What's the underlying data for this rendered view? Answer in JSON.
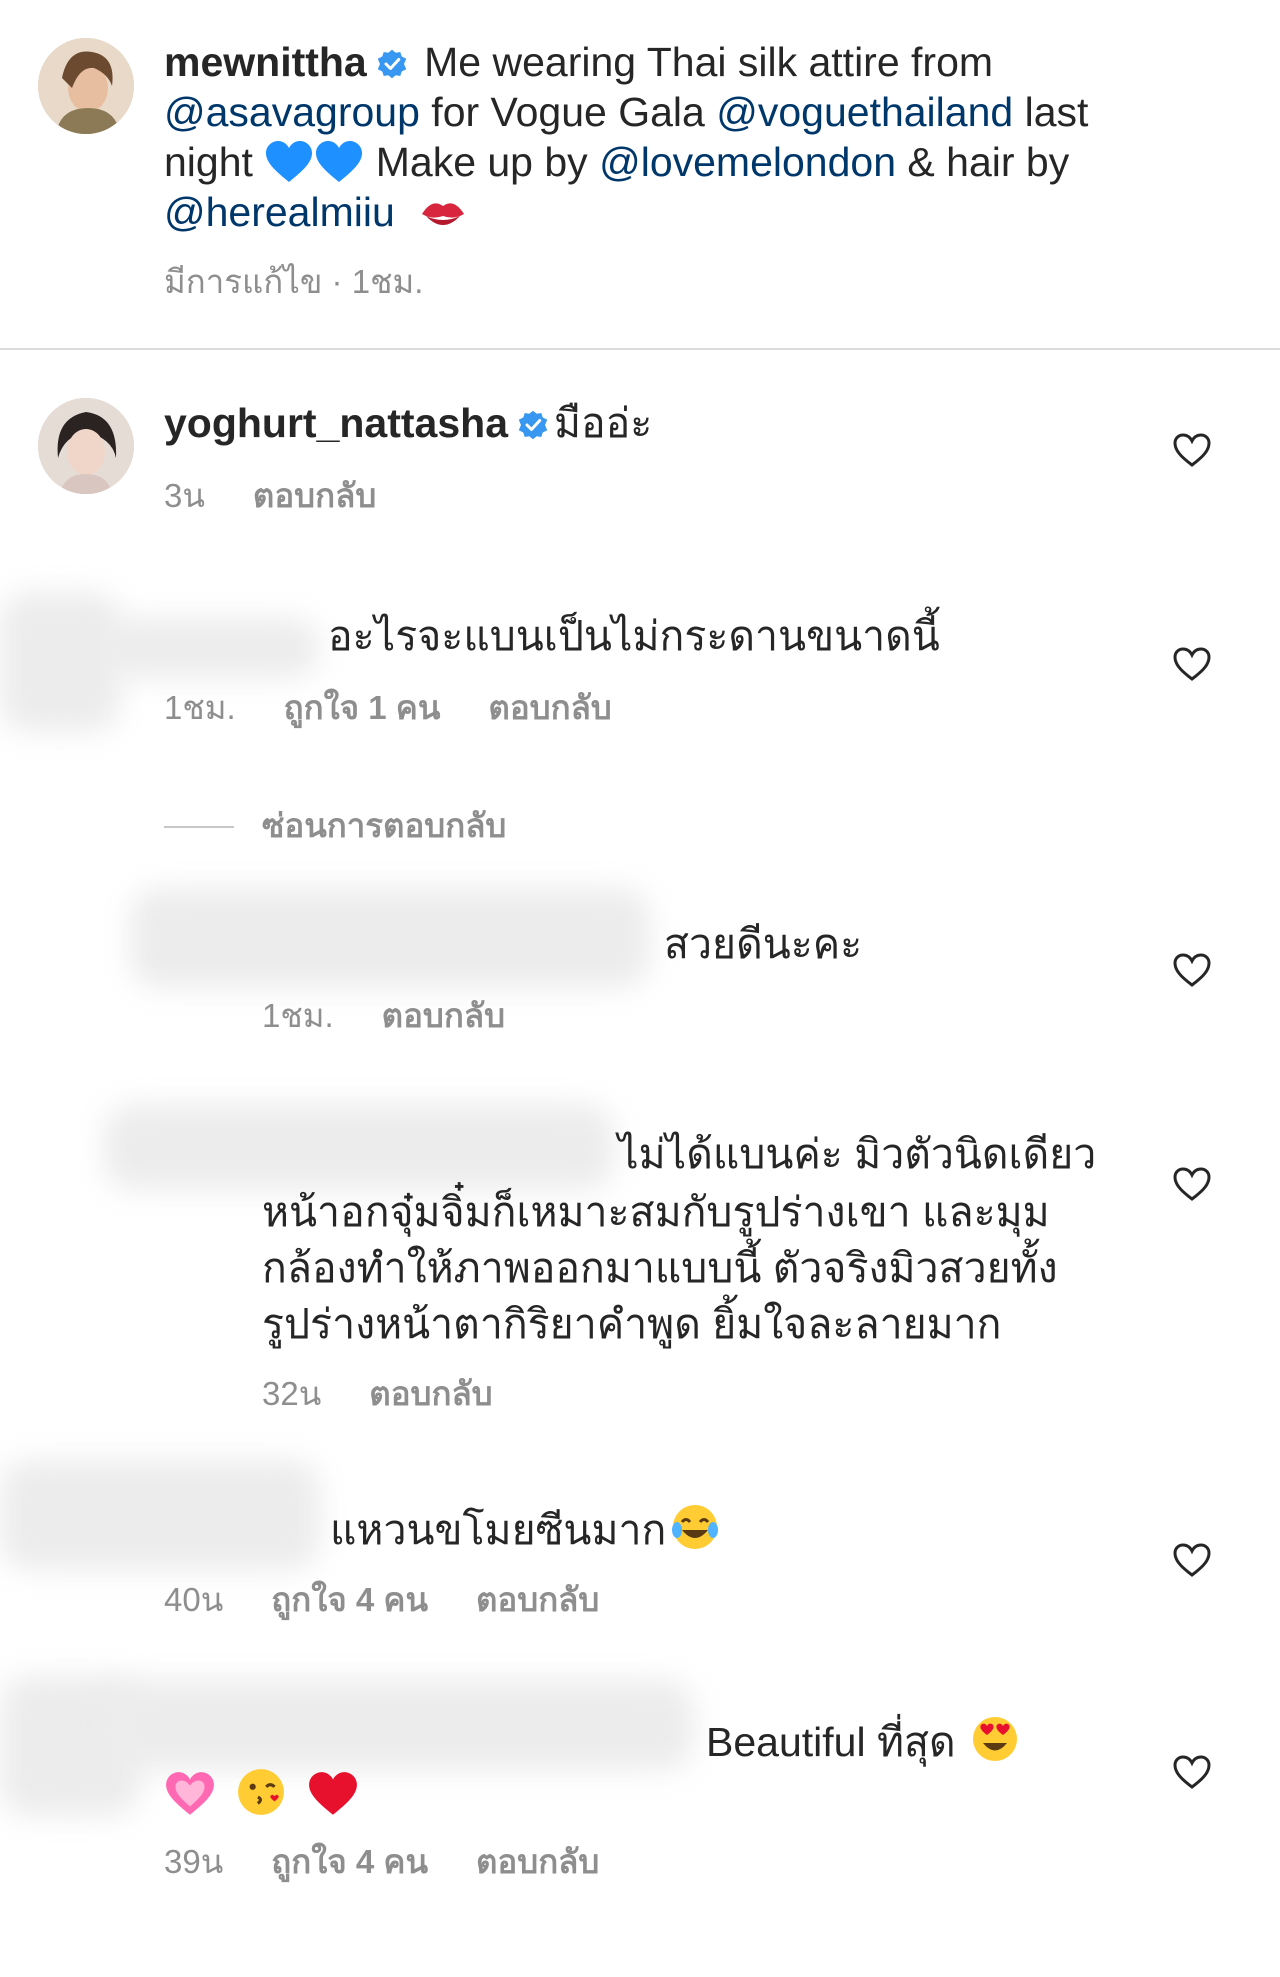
{
  "caption": {
    "username": "mewnittha",
    "line1_text": "Me wearing Thai silk attire from",
    "mention1": "@asavagroup",
    "line2_mid": "for Vogue Gala",
    "mention2": "@voguethailand",
    "line2_end": "last",
    "line3_start": "night",
    "line3_mid": "Make up by",
    "mention3": "@lovemelondon",
    "line3_end": "& hair by",
    "mention4": "@herealmiiu",
    "meta_edited": "มีการแก้ไข · 1ชม."
  },
  "comments": [
    {
      "username": "yoghurt_nattasha",
      "text": "มืออ่ะ",
      "time": "3น",
      "reply": "ตอบกลับ"
    },
    {
      "text": "อะไรจะแบนเป็นไม่กระดานขนาดนี้",
      "time": "1ชม.",
      "likes": "ถูกใจ 1 คน",
      "reply": "ตอบกลับ",
      "hide_replies": "ซ่อนการตอบกลับ"
    },
    {
      "text": "สวยดีนะคะ",
      "time": "1ชม.",
      "reply": "ตอบกลับ"
    },
    {
      "lines": [
        "ไม่ได้แบนค่ะ มิวตัวนิดเดียว",
        "หน้าอกจุ๋มจิ๋มก็เหมาะสมกับรูปร่างเขา และมุม",
        "กล้องทำให้ภาพออกมาแบบนี้ ตัวจริงมิวสวยทั้ง",
        "รูปร่างหน้าตากิริยาคำพูด ยิ้มใจละลายมาก"
      ],
      "time": "32น",
      "reply": "ตอบกลับ"
    },
    {
      "text": "แหวนขโมยซีนมาก",
      "time": "40น",
      "likes": "ถูกใจ 4 คน",
      "reply": "ตอบกลับ"
    },
    {
      "text": "Beautiful  ที่สุด",
      "time": "39น",
      "likes": "ถูกใจ 4 คน",
      "reply": "ตอบกลับ"
    }
  ],
  "icons": {
    "verified": "verified-badge-icon",
    "heart": "heart-outline-icon"
  },
  "colors": {
    "mention": "#00376b",
    "verified": "#3897f0",
    "meta": "#8e8e8e"
  }
}
